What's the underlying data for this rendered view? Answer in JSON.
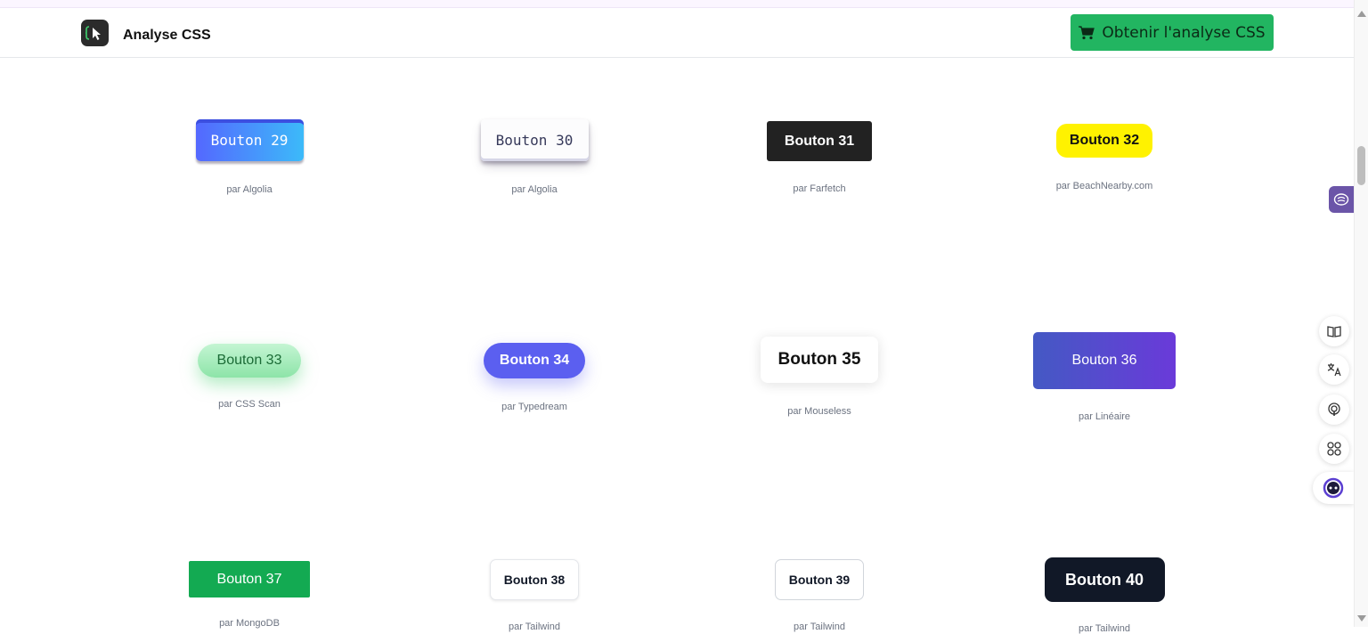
{
  "header": {
    "brand": "Analyse CSS",
    "cta_label": "Obtenir l'analyse CSS"
  },
  "buttons": [
    {
      "label": "Bouton 29",
      "by": "par Algolia"
    },
    {
      "label": "Bouton 30",
      "by": "par Algolia"
    },
    {
      "label": "Bouton 31",
      "by": "par Farfetch"
    },
    {
      "label": "Bouton 32",
      "by": "par BeachNearby.com"
    },
    {
      "label": "Bouton 33",
      "by": "par CSS Scan"
    },
    {
      "label": "Bouton 34",
      "by": "par Typedream"
    },
    {
      "label": "Bouton 35",
      "by": "par Mouseless"
    },
    {
      "label": "Bouton 36",
      "by": "par Linéaire"
    },
    {
      "label": "Bouton 37",
      "by": "par MongoDB"
    },
    {
      "label": "Bouton 38",
      "by": "par Tailwind"
    },
    {
      "label": "Bouton 39",
      "by": "par Tailwind"
    },
    {
      "label": "Bouton 40",
      "by": "par Tailwind"
    }
  ],
  "sidebar_tools": [
    "book-icon",
    "translate-icon",
    "podcast-icon",
    "command-icon",
    "assistant-icon"
  ],
  "colors": {
    "cta": "#22b561",
    "extension_tab": "#6b55a8"
  }
}
